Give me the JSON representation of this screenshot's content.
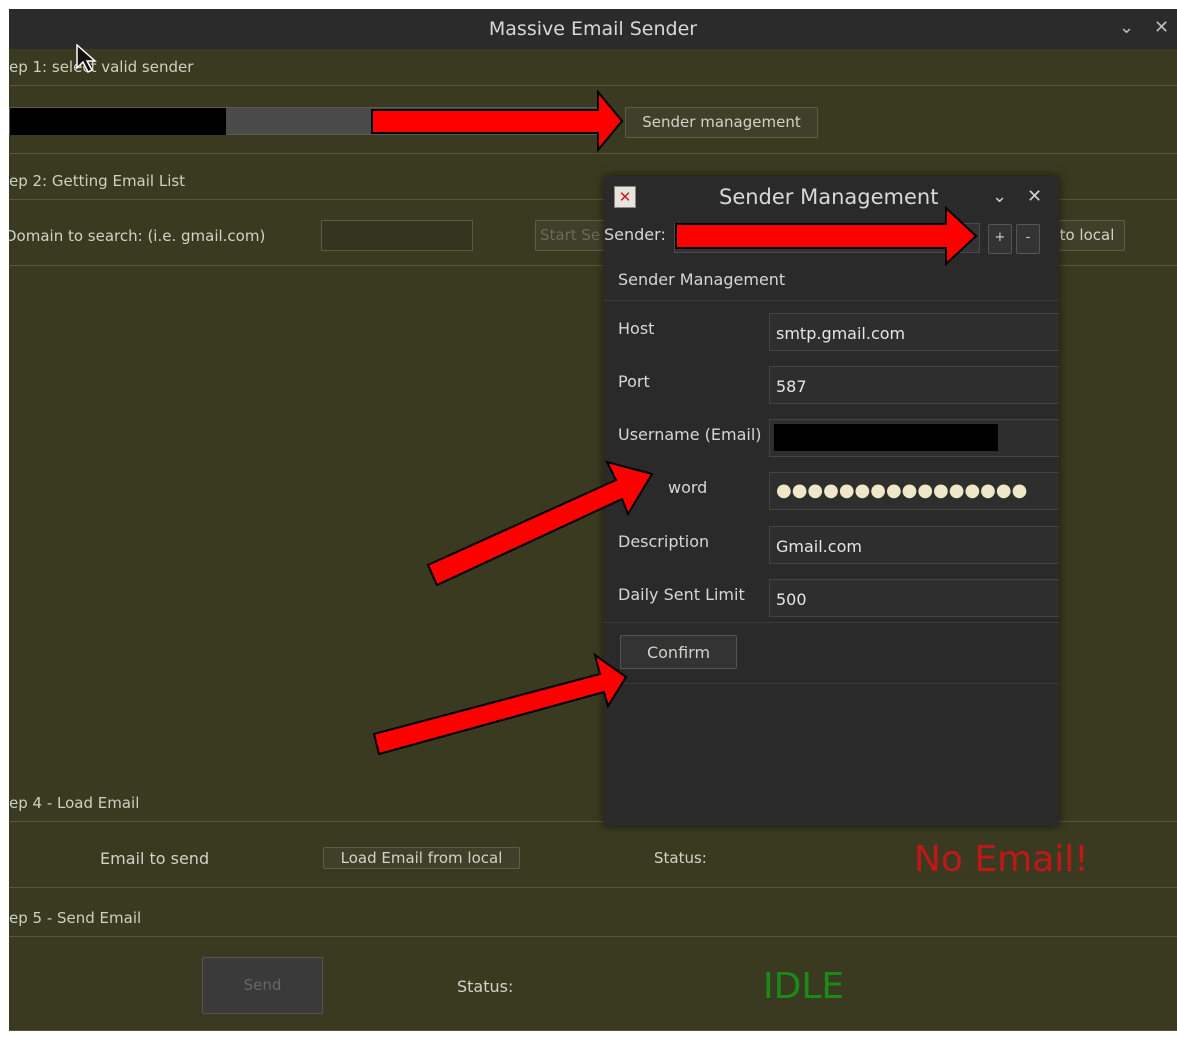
{
  "window": {
    "title": "Massive Email Sender",
    "minimize_glyph": "⌄",
    "close_glyph": "✕"
  },
  "step1": {
    "heading": "ep 1: select valid sender",
    "sender_management_label": "Sender management"
  },
  "step2": {
    "heading": "ep 2: Getting Email List",
    "domain_label": "Domain to search: (i.e. gmail.com)",
    "start_button_label": "Start Se",
    "load_local_label": "to local"
  },
  "step4": {
    "heading": "ep 4 - Load Email",
    "email_to_send_label": "Email to send",
    "load_email_label": "Load Email from local",
    "status_label": "Status:",
    "status_value": "No Email!",
    "status_color": "#c01818"
  },
  "step5": {
    "heading": "ep 5 - Send Email",
    "send_label": "Send",
    "status_label": "Status:",
    "status_value": "IDLE",
    "status_color": "#1a8a1a"
  },
  "dialog": {
    "title": "Sender Management",
    "sender_label": "Sender:",
    "add_label": "+",
    "remove_label": "-",
    "section_title": "Sender Management",
    "fields": [
      {
        "label": "Host",
        "value": "smtp.gmail.com"
      },
      {
        "label": "Port",
        "value": "587"
      },
      {
        "label": "Username (Email)",
        "value": ""
      },
      {
        "label": "Password",
        "value": "●●●●●●●●●●●●●●●●"
      },
      {
        "label": "Description",
        "value": "Gmail.com"
      },
      {
        "label": "Daily Sent Limit",
        "value": "500"
      }
    ],
    "password_label_visible": "word",
    "confirm_label": "Confirm"
  },
  "annotation_color": "#ff0000"
}
